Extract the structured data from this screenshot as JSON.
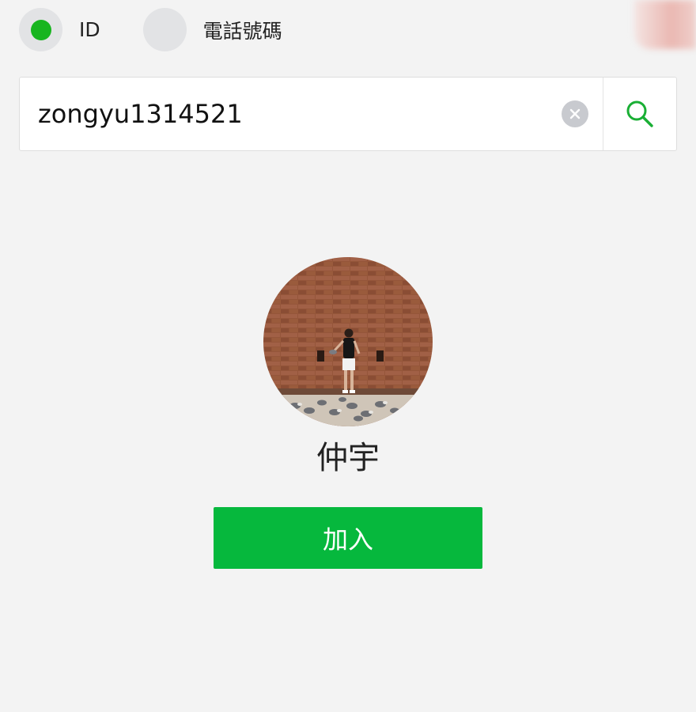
{
  "search_type": {
    "options": [
      {
        "label": "ID",
        "selected": true
      },
      {
        "label": "電話號碼",
        "selected": false
      }
    ]
  },
  "search": {
    "value": "zongyu1314521"
  },
  "profile": {
    "name": "仲宇"
  },
  "actions": {
    "add_label": "加入"
  },
  "icons": {
    "clear": "clear-icon",
    "search": "search-icon"
  },
  "colors": {
    "accent_green": "#06b83d",
    "radio_selected": "#18b51f",
    "background": "#f3f3f3"
  }
}
